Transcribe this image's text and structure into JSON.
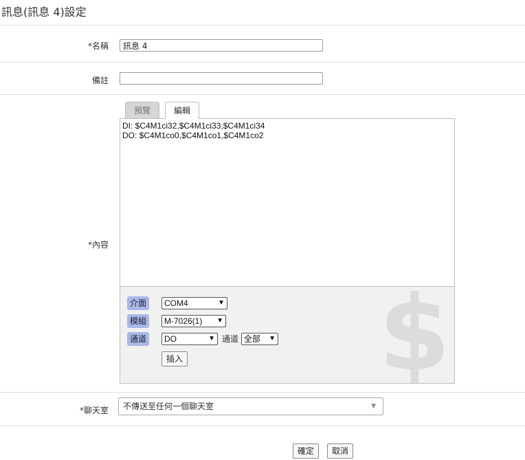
{
  "page_title": "訊息(訊息 4)設定",
  "fields": {
    "name": {
      "label": "*名稱",
      "value": "訊息 4"
    },
    "note": {
      "label": "備註",
      "value": ""
    },
    "content": {
      "label": "*內容",
      "tabs": {
        "preview": "預覽",
        "edit": "編輯"
      },
      "text": "DI: $C4M1ci32,$C4M1ci33,$C4M1ci34\nDO: $C4M1co0,$C4M1co1,$C4M1co2",
      "insert": {
        "interface_label": "介面",
        "interface_value": "COM4",
        "module_label": "模組",
        "module_value": "M-7026(1)",
        "channel_label": "通道",
        "channel_value": "DO",
        "channel_sub_label": "通道",
        "channel_sub_value": "全部",
        "insert_button": "插入",
        "watermark": "$"
      }
    },
    "chatroom": {
      "label": "*聊天室",
      "value": "不傳送至任何一個聊天室"
    }
  },
  "buttons": {
    "ok": "確定",
    "cancel": "取消"
  },
  "icons": {
    "dropdown": "chevron-down-icon"
  }
}
